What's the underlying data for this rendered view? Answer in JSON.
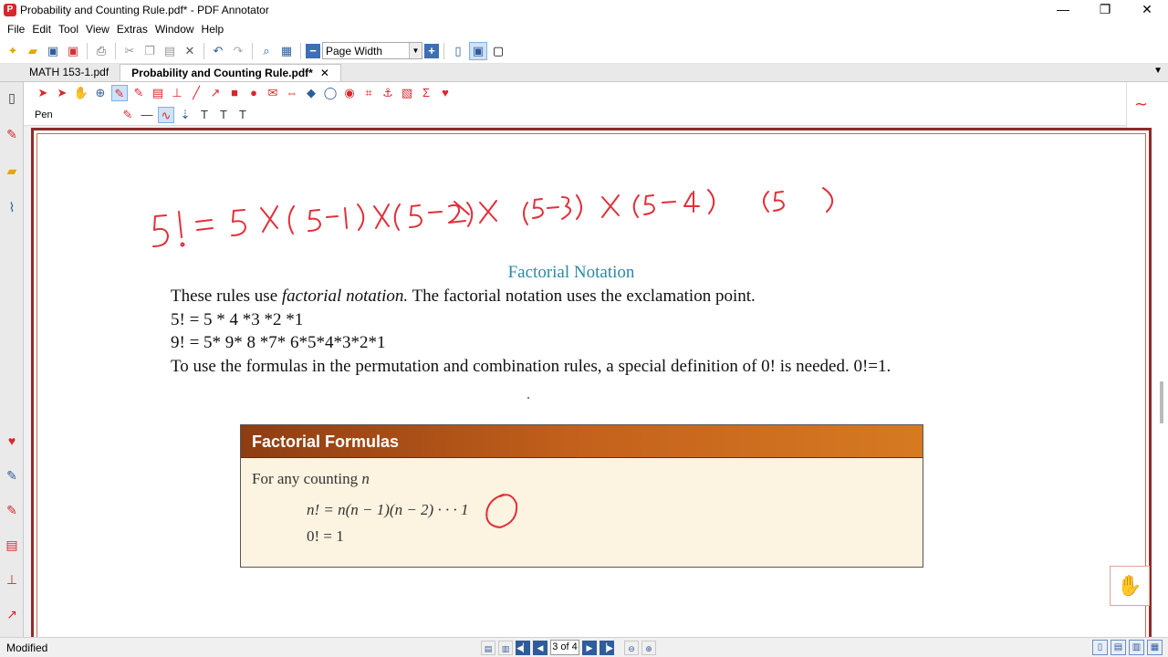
{
  "window": {
    "title": "Probability and Counting Rule.pdf* - PDF Annotator",
    "minimize": "—",
    "maximize": "❐",
    "close": "✕"
  },
  "menu": [
    "File",
    "Edit",
    "Tool",
    "View",
    "Extras",
    "Window",
    "Help"
  ],
  "toolbar": {
    "zoom_value": "Page Width",
    "zoom_out": "−",
    "zoom_in": "+"
  },
  "tabs": [
    {
      "label": "MATH 153-1.pdf",
      "active": false
    },
    {
      "label": "Probability and Counting Rule.pdf*",
      "active": true
    }
  ],
  "tab_close": "✕",
  "annot_toolbar": {
    "tool_label": "Pen"
  },
  "document": {
    "handwriting": "5! = 5 × (5−1) × (5−2) × (5−3) × (5−4)  (5 )",
    "heading": "Factorial Notation",
    "line1_a": "These rules use ",
    "line1_em": "factorial notation.",
    "line1_b": " The factorial notation uses the exclamation point.",
    "line2": "5! = 5 * 4 *3 *2 *1",
    "line3": "9! = 5* 9* 8 *7* 6*5*4*3*2*1",
    "line4": "To use the formulas in the permutation and combination rules, a special definition of 0! is needed. 0!=1.",
    "box": {
      "title": "Factorial Formulas",
      "intro": "For any counting ",
      "intro_var": "n",
      "formula1": "n! = n(n − 1)(n − 2) · · · 1",
      "formula2": "0! = 1"
    }
  },
  "status": {
    "text": "Modified",
    "page": "3 of 4"
  },
  "colors": {
    "accent": "#2f5c9a",
    "ink": "#e0303a",
    "heading": "#2a8aa3",
    "frame": "#8f2a2a"
  }
}
